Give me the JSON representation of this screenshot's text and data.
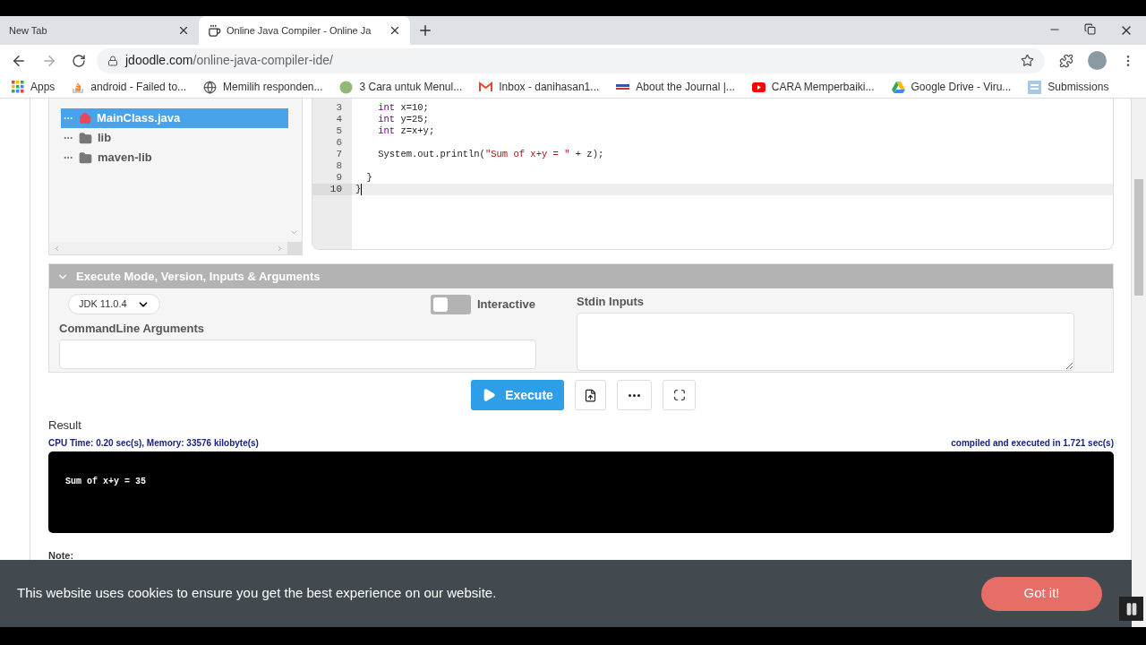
{
  "browser": {
    "tabs": [
      {
        "title": "New Tab",
        "selected": false
      },
      {
        "title": "Online Java Compiler - Online Ja",
        "selected": true
      }
    ],
    "url_host": "jdoodle.com",
    "url_path": "/online-java-compiler-ide/",
    "bookmarks": [
      {
        "label": "Apps",
        "kind": "apps"
      },
      {
        "label": "android - Failed to...",
        "kind": "stack"
      },
      {
        "label": "Memilih responden...",
        "kind": "globe"
      },
      {
        "label": "3 Cara untuk Menul...",
        "kind": "wh"
      },
      {
        "label": "Inbox - danihasan1...",
        "kind": "gmail"
      },
      {
        "label": "About the Journal |...",
        "kind": "journal"
      },
      {
        "label": "CARA Memperbaiki...",
        "kind": "youtube"
      },
      {
        "label": "Google Drive - Viru...",
        "kind": "drive"
      },
      {
        "label": "Submissions",
        "kind": "doc"
      }
    ]
  },
  "file_tree": [
    {
      "name": "MainClass.java",
      "kind": "file",
      "selected": true
    },
    {
      "name": "lib",
      "kind": "folder",
      "selected": false
    },
    {
      "name": "maven-lib",
      "kind": "folder",
      "selected": false
    }
  ],
  "editor": {
    "lines": [
      {
        "number": "3",
        "current": false,
        "tokens": [
          {
            "text": "    int",
            "kind": "keyword"
          },
          {
            "text": " x=10;",
            "kind": "plain"
          }
        ]
      },
      {
        "number": "4",
        "current": false,
        "tokens": [
          {
            "text": "    int",
            "kind": "keyword"
          },
          {
            "text": " y=25;",
            "kind": "plain"
          }
        ]
      },
      {
        "number": "5",
        "current": false,
        "tokens": [
          {
            "text": "    int",
            "kind": "keyword"
          },
          {
            "text": " z=x+y;",
            "kind": "plain"
          }
        ]
      },
      {
        "number": "6",
        "current": false
      },
      {
        "number": "7",
        "current": false,
        "tokens": [
          {
            "text": "    System.out.println(",
            "kind": "plain"
          },
          {
            "text": "\"Sum of x+y = \"",
            "kind": "string"
          },
          {
            "text": " + z);",
            "kind": "plain"
          }
        ]
      },
      {
        "number": "8",
        "current": false
      },
      {
        "number": "9",
        "current": false,
        "tokens": [
          {
            "text": "  }",
            "kind": "plain"
          }
        ]
      },
      {
        "number": "10",
        "current": true,
        "tokens": [
          {
            "text": "}",
            "kind": "plain"
          }
        ]
      }
    ]
  },
  "execute_panel": {
    "title": "Execute Mode, Version, Inputs & Arguments",
    "expanded": true,
    "version": "JDK 11.0.4",
    "interactive": {
      "label": "Interactive",
      "on": false
    },
    "args_label": "CommandLine Arguments",
    "stdin_label": "Stdin Inputs"
  },
  "execute_button": "Execute",
  "result": {
    "title": "Result",
    "stats": "CPU Time: 0.20 sec(s), Memory: 33576 kilobyte(s)",
    "timing": "compiled and executed in 1.721 sec(s)",
    "output": "Sum of x+y = 35"
  },
  "note": "Note:",
  "cookie": {
    "message": "This website uses cookies to ensure you get the best experience on our website.",
    "button": "Got it!"
  }
}
